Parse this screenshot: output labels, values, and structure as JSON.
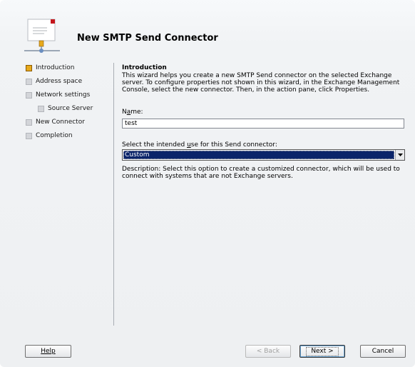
{
  "window": {
    "title": "New SMTP Send Connector"
  },
  "header_icon": "send-connector-wizard-icon",
  "nav": {
    "items": [
      {
        "label": "Introduction",
        "active": true
      },
      {
        "label": "Address space",
        "active": false
      },
      {
        "label": "Network settings",
        "active": false
      },
      {
        "label": "Source Server",
        "active": false
      },
      {
        "label": "New Connector",
        "active": false
      },
      {
        "label": "Completion",
        "active": false
      }
    ]
  },
  "main": {
    "section_title": "Introduction",
    "intro_text": "This wizard helps you create a new SMTP Send connector on the selected Exchange server. To configure properties not shown in this wizard, in the Exchange Management Console, select the new connector. Then, in the action pane, click Properties.",
    "name_label": "Name:",
    "name_value": "test",
    "use_label": "Select the intended use for this Send connector:",
    "use_selected": "Custom",
    "description": "Description: Select this option to create a customized connector, which will be used to connect with systems that are not Exchange servers."
  },
  "buttons": {
    "help": "Help",
    "back": "< Back",
    "next": "Next >",
    "cancel": "Cancel"
  },
  "colors": {
    "active_step": "#e7a91c",
    "selection": "#0a246a"
  }
}
